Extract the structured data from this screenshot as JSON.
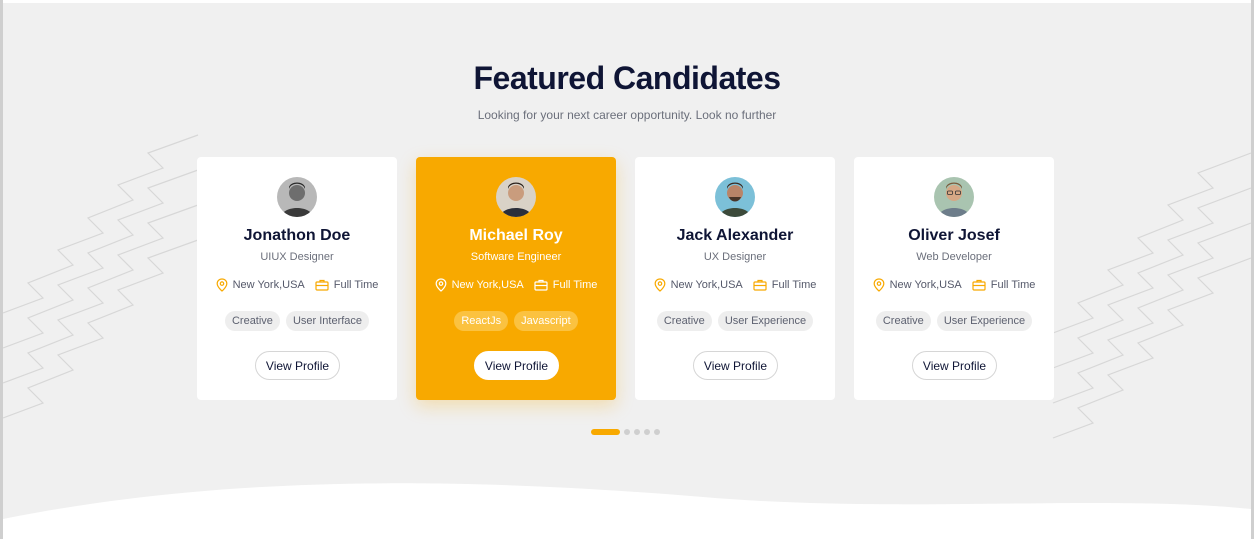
{
  "section": {
    "title": "Featured Candidates",
    "subtitle": "Looking for your next career opportunity. Look no further"
  },
  "candidates": [
    {
      "name": "Jonathon Doe",
      "role": "UIUX Designer",
      "location": "New York,USA",
      "job_type": "Full Time",
      "tags": [
        "Creative",
        "User Interface"
      ],
      "button": "View Profile",
      "active": false
    },
    {
      "name": "Michael Roy",
      "role": "Software Engineer",
      "location": "New York,USA",
      "job_type": "Full Time",
      "tags": [
        "ReactJs",
        "Javascript"
      ],
      "button": "View Profile",
      "active": true
    },
    {
      "name": "Jack Alexander",
      "role": "UX Designer",
      "location": "New York,USA",
      "job_type": "Full Time",
      "tags": [
        "Creative",
        "User Experience"
      ],
      "button": "View Profile",
      "active": false
    },
    {
      "name": "Oliver Josef",
      "role": "Web Developer",
      "location": "New York,USA",
      "job_type": "Full Time",
      "tags": [
        "Creative",
        "User Experience"
      ],
      "button": "View Profile",
      "active": false
    }
  ],
  "pagination": {
    "count": 5,
    "active_index": 0
  },
  "colors": {
    "accent": "#f8a900",
    "heading": "#0f1535",
    "background": "#f0f0f0",
    "card": "#ffffff"
  },
  "icons": {
    "location": "location-pin-icon",
    "job_type": "briefcase-icon"
  }
}
